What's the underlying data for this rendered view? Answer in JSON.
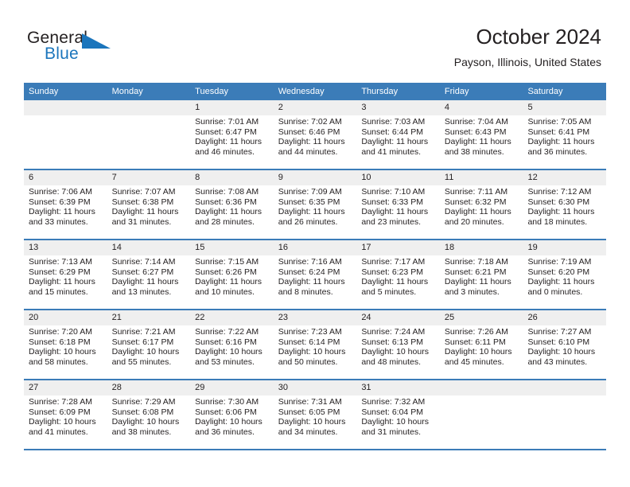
{
  "branding": {
    "logo_general": "General",
    "logo_blue": "Blue",
    "logo_triangle_icon": "triangle-icon",
    "brand_color": "#1b75bc"
  },
  "header": {
    "title": "October 2024",
    "location": "Payson, Illinois, United States",
    "header_bg_color": "#3b7cb8",
    "daynum_bg_color": "#efefef"
  },
  "weekdays": [
    "Sunday",
    "Monday",
    "Tuesday",
    "Wednesday",
    "Thursday",
    "Friday",
    "Saturday"
  ],
  "weeks": [
    [
      {
        "day": "",
        "lines": [
          "",
          "",
          "",
          ""
        ],
        "empty": true
      },
      {
        "day": "",
        "lines": [
          "",
          "",
          "",
          ""
        ],
        "empty": true
      },
      {
        "day": "1",
        "lines": [
          "Sunrise: 7:01 AM",
          "Sunset: 6:47 PM",
          "Daylight: 11 hours",
          "and 46 minutes."
        ]
      },
      {
        "day": "2",
        "lines": [
          "Sunrise: 7:02 AM",
          "Sunset: 6:46 PM",
          "Daylight: 11 hours",
          "and 44 minutes."
        ]
      },
      {
        "day": "3",
        "lines": [
          "Sunrise: 7:03 AM",
          "Sunset: 6:44 PM",
          "Daylight: 11 hours",
          "and 41 minutes."
        ]
      },
      {
        "day": "4",
        "lines": [
          "Sunrise: 7:04 AM",
          "Sunset: 6:43 PM",
          "Daylight: 11 hours",
          "and 38 minutes."
        ]
      },
      {
        "day": "5",
        "lines": [
          "Sunrise: 7:05 AM",
          "Sunset: 6:41 PM",
          "Daylight: 11 hours",
          "and 36 minutes."
        ]
      }
    ],
    [
      {
        "day": "6",
        "lines": [
          "Sunrise: 7:06 AM",
          "Sunset: 6:39 PM",
          "Daylight: 11 hours",
          "and 33 minutes."
        ]
      },
      {
        "day": "7",
        "lines": [
          "Sunrise: 7:07 AM",
          "Sunset: 6:38 PM",
          "Daylight: 11 hours",
          "and 31 minutes."
        ]
      },
      {
        "day": "8",
        "lines": [
          "Sunrise: 7:08 AM",
          "Sunset: 6:36 PM",
          "Daylight: 11 hours",
          "and 28 minutes."
        ]
      },
      {
        "day": "9",
        "lines": [
          "Sunrise: 7:09 AM",
          "Sunset: 6:35 PM",
          "Daylight: 11 hours",
          "and 26 minutes."
        ]
      },
      {
        "day": "10",
        "lines": [
          "Sunrise: 7:10 AM",
          "Sunset: 6:33 PM",
          "Daylight: 11 hours",
          "and 23 minutes."
        ]
      },
      {
        "day": "11",
        "lines": [
          "Sunrise: 7:11 AM",
          "Sunset: 6:32 PM",
          "Daylight: 11 hours",
          "and 20 minutes."
        ]
      },
      {
        "day": "12",
        "lines": [
          "Sunrise: 7:12 AM",
          "Sunset: 6:30 PM",
          "Daylight: 11 hours",
          "and 18 minutes."
        ]
      }
    ],
    [
      {
        "day": "13",
        "lines": [
          "Sunrise: 7:13 AM",
          "Sunset: 6:29 PM",
          "Daylight: 11 hours",
          "and 15 minutes."
        ]
      },
      {
        "day": "14",
        "lines": [
          "Sunrise: 7:14 AM",
          "Sunset: 6:27 PM",
          "Daylight: 11 hours",
          "and 13 minutes."
        ]
      },
      {
        "day": "15",
        "lines": [
          "Sunrise: 7:15 AM",
          "Sunset: 6:26 PM",
          "Daylight: 11 hours",
          "and 10 minutes."
        ]
      },
      {
        "day": "16",
        "lines": [
          "Sunrise: 7:16 AM",
          "Sunset: 6:24 PM",
          "Daylight: 11 hours",
          "and 8 minutes."
        ]
      },
      {
        "day": "17",
        "lines": [
          "Sunrise: 7:17 AM",
          "Sunset: 6:23 PM",
          "Daylight: 11 hours",
          "and 5 minutes."
        ]
      },
      {
        "day": "18",
        "lines": [
          "Sunrise: 7:18 AM",
          "Sunset: 6:21 PM",
          "Daylight: 11 hours",
          "and 3 minutes."
        ]
      },
      {
        "day": "19",
        "lines": [
          "Sunrise: 7:19 AM",
          "Sunset: 6:20 PM",
          "Daylight: 11 hours",
          "and 0 minutes."
        ]
      }
    ],
    [
      {
        "day": "20",
        "lines": [
          "Sunrise: 7:20 AM",
          "Sunset: 6:18 PM",
          "Daylight: 10 hours",
          "and 58 minutes."
        ]
      },
      {
        "day": "21",
        "lines": [
          "Sunrise: 7:21 AM",
          "Sunset: 6:17 PM",
          "Daylight: 10 hours",
          "and 55 minutes."
        ]
      },
      {
        "day": "22",
        "lines": [
          "Sunrise: 7:22 AM",
          "Sunset: 6:16 PM",
          "Daylight: 10 hours",
          "and 53 minutes."
        ]
      },
      {
        "day": "23",
        "lines": [
          "Sunrise: 7:23 AM",
          "Sunset: 6:14 PM",
          "Daylight: 10 hours",
          "and 50 minutes."
        ]
      },
      {
        "day": "24",
        "lines": [
          "Sunrise: 7:24 AM",
          "Sunset: 6:13 PM",
          "Daylight: 10 hours",
          "and 48 minutes."
        ]
      },
      {
        "day": "25",
        "lines": [
          "Sunrise: 7:26 AM",
          "Sunset: 6:11 PM",
          "Daylight: 10 hours",
          "and 45 minutes."
        ]
      },
      {
        "day": "26",
        "lines": [
          "Sunrise: 7:27 AM",
          "Sunset: 6:10 PM",
          "Daylight: 10 hours",
          "and 43 minutes."
        ]
      }
    ],
    [
      {
        "day": "27",
        "lines": [
          "Sunrise: 7:28 AM",
          "Sunset: 6:09 PM",
          "Daylight: 10 hours",
          "and 41 minutes."
        ]
      },
      {
        "day": "28",
        "lines": [
          "Sunrise: 7:29 AM",
          "Sunset: 6:08 PM",
          "Daylight: 10 hours",
          "and 38 minutes."
        ]
      },
      {
        "day": "29",
        "lines": [
          "Sunrise: 7:30 AM",
          "Sunset: 6:06 PM",
          "Daylight: 10 hours",
          "and 36 minutes."
        ]
      },
      {
        "day": "30",
        "lines": [
          "Sunrise: 7:31 AM",
          "Sunset: 6:05 PM",
          "Daylight: 10 hours",
          "and 34 minutes."
        ]
      },
      {
        "day": "31",
        "lines": [
          "Sunrise: 7:32 AM",
          "Sunset: 6:04 PM",
          "Daylight: 10 hours",
          "and 31 minutes."
        ]
      },
      {
        "day": "",
        "lines": [
          "",
          "",
          "",
          ""
        ],
        "empty": true
      },
      {
        "day": "",
        "lines": [
          "",
          "",
          "",
          ""
        ],
        "empty": true
      }
    ]
  ]
}
